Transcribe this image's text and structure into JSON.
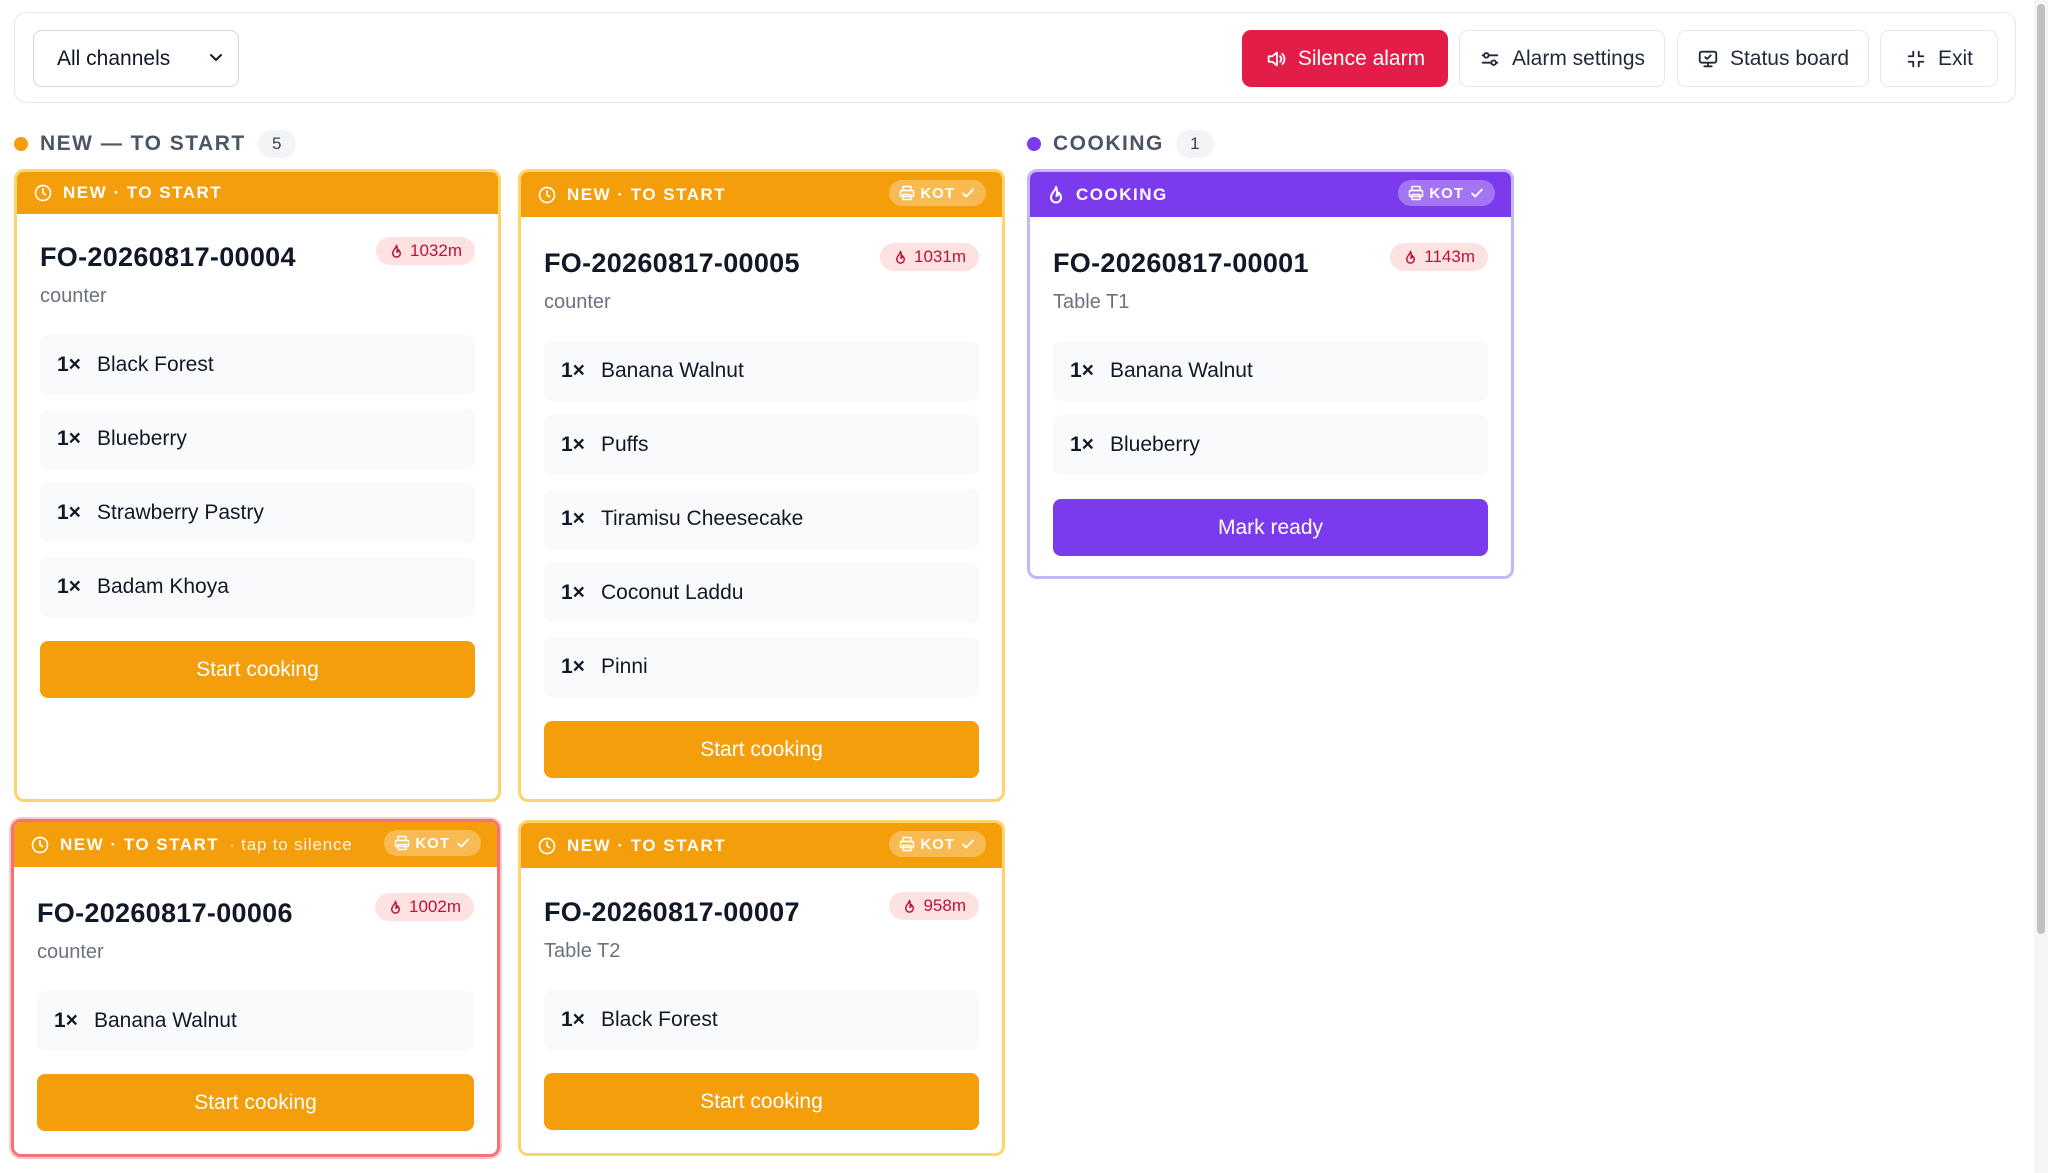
{
  "toolbar": {
    "channel_select": "All channels",
    "silence_label": "Silence alarm",
    "alarm_settings_label": "Alarm settings",
    "status_board_label": "Status board",
    "exit_label": "Exit"
  },
  "colors": {
    "new": "#f59e0b",
    "cooking": "#7c3aed",
    "danger": "#e11d48"
  },
  "columns": [
    {
      "title": "NEW — TO START",
      "count": "5"
    },
    {
      "title": "COOKING",
      "count": "1"
    }
  ],
  "cards": [
    {
      "banner": "NEW · TO START",
      "hint": "",
      "kot": "",
      "order": "FO-20260817-00004",
      "timer": "1032m",
      "sub": "counter",
      "items": [
        {
          "qty": "1×",
          "name": "Black Forest"
        },
        {
          "qty": "1×",
          "name": "Blueberry"
        },
        {
          "qty": "1×",
          "name": "Strawberry Pastry"
        },
        {
          "qty": "1×",
          "name": "Badam Khoya"
        }
      ],
      "action": "Start cooking"
    },
    {
      "banner": "NEW · TO START",
      "hint": "",
      "kot": "KOT",
      "order": "FO-20260817-00005",
      "timer": "1031m",
      "sub": "counter",
      "items": [
        {
          "qty": "1×",
          "name": "Banana Walnut"
        },
        {
          "qty": "1×",
          "name": "Puffs"
        },
        {
          "qty": "1×",
          "name": "Tiramisu Cheesecake"
        },
        {
          "qty": "1×",
          "name": "Coconut Laddu"
        },
        {
          "qty": "1×",
          "name": "Pinni"
        }
      ],
      "action": "Start cooking"
    },
    {
      "banner": "COOKING",
      "hint": "",
      "kot": "KOT",
      "order": "FO-20260817-00001",
      "timer": "1143m",
      "sub": "Table T1",
      "items": [
        {
          "qty": "1×",
          "name": "Banana Walnut"
        },
        {
          "qty": "1×",
          "name": "Blueberry"
        }
      ],
      "action": "Mark ready"
    },
    {
      "banner": "NEW · TO START",
      "hint": "· tap to silence",
      "kot": "KOT",
      "order": "FO-20260817-00006",
      "timer": "1002m",
      "sub": "counter",
      "items": [
        {
          "qty": "1×",
          "name": "Banana Walnut"
        }
      ],
      "action": "Start cooking"
    },
    {
      "banner": "NEW · TO START",
      "hint": "",
      "kot": "KOT",
      "order": "FO-20260817-00007",
      "timer": "958m",
      "sub": "Table T2",
      "items": [
        {
          "qty": "1×",
          "name": "Black Forest"
        }
      ],
      "action": "Start cooking"
    }
  ]
}
